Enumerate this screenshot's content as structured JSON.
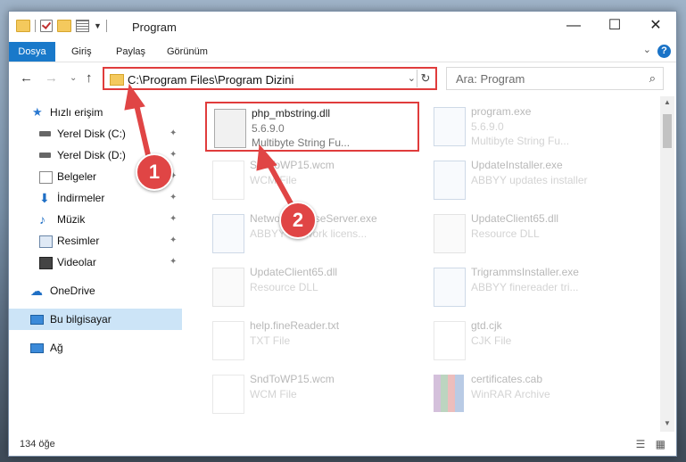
{
  "window": {
    "title": "Program",
    "minimize_glyph": "—",
    "maximize_glyph": "☐",
    "close_glyph": "✕"
  },
  "ribbon": {
    "tabs": [
      "Dosya",
      "Giriş",
      "Paylaş",
      "Görünüm"
    ],
    "help_glyph": "?",
    "expand_glyph": "⌄"
  },
  "nav": {
    "back_glyph": "←",
    "forward_glyph": "→",
    "recent_glyph": "⌄",
    "up_glyph": "↑"
  },
  "address": {
    "path": "C:\\Program Files\\Program Dizini",
    "dropdown_glyph": "⌄",
    "refresh_glyph": "↻"
  },
  "search": {
    "placeholder": "Ara: Program",
    "icon_glyph": "⌕"
  },
  "sidebar": {
    "items": [
      {
        "label": "Hızlı erişim",
        "icon": "star-icon"
      },
      {
        "label": "Yerel Disk (C:)",
        "icon": "drive-icon"
      },
      {
        "label": "Yerel Disk (D:)",
        "icon": "drive-icon"
      },
      {
        "label": "Belgeler",
        "icon": "documents-icon"
      },
      {
        "label": "İndirmeler",
        "icon": "download-icon"
      },
      {
        "label": "Müzik",
        "icon": "music-icon"
      },
      {
        "label": "Resimler",
        "icon": "pictures-icon"
      },
      {
        "label": "Videolar",
        "icon": "videos-icon"
      },
      {
        "label": "OneDrive",
        "icon": "cloud-icon"
      },
      {
        "label": "Bu bilgisayar",
        "icon": "computer-icon"
      },
      {
        "label": "Ağ",
        "icon": "network-icon"
      }
    ],
    "pin_glyph": "📌"
  },
  "files": [
    {
      "name": "php_mbstring.dll",
      "line2": "5.6.9.0",
      "line3": "Multibyte String Fu...",
      "icon": "dll-icon"
    },
    {
      "name": "program.exe",
      "line2": "5.6.9.0",
      "line3": "Multibyte String Fu...",
      "icon": "exe-icon"
    },
    {
      "name": "SndToWP15.wcm",
      "line2": "WCM File",
      "line3": "",
      "icon": "document-icon"
    },
    {
      "name": "UpdateInstaller.exe",
      "line2": "ABBYY updates installer",
      "line3": "",
      "icon": "exe-icon"
    },
    {
      "name": "NetworkLicenseServer.exe",
      "line2": "ABBYY Network licens...",
      "line3": "",
      "icon": "exe-icon"
    },
    {
      "name": "UpdateClient65.dll",
      "line2": "Resource DLL",
      "line3": "",
      "icon": "dll-icon"
    },
    {
      "name": "UpdateClient65.dll",
      "line2": "Resource DLL",
      "line3": "",
      "icon": "dll-icon"
    },
    {
      "name": "TrigrammsInstaller.exe",
      "line2": "ABBYY finereader tri...",
      "line3": "",
      "icon": "exe-icon"
    },
    {
      "name": "help.fineReader.txt",
      "line2": "TXT File",
      "line3": "",
      "icon": "document-icon"
    },
    {
      "name": "gtd.cjk",
      "line2": "CJK File",
      "line3": "",
      "icon": "document-icon"
    },
    {
      "name": "SndToWP15.wcm",
      "line2": "WCM File",
      "line3": "",
      "icon": "document-icon"
    },
    {
      "name": "certificates.cab",
      "line2": "WinRAR Archive",
      "line3": "",
      "icon": "archive-icon"
    }
  ],
  "status": {
    "count": "134 öğe",
    "view_glyphs": "☰ ▦"
  },
  "callouts": {
    "one": "1",
    "two": "2"
  },
  "colors": {
    "accent": "#1979ca",
    "highlight": "#e03c3c",
    "selected_bg": "#cce4f7"
  }
}
